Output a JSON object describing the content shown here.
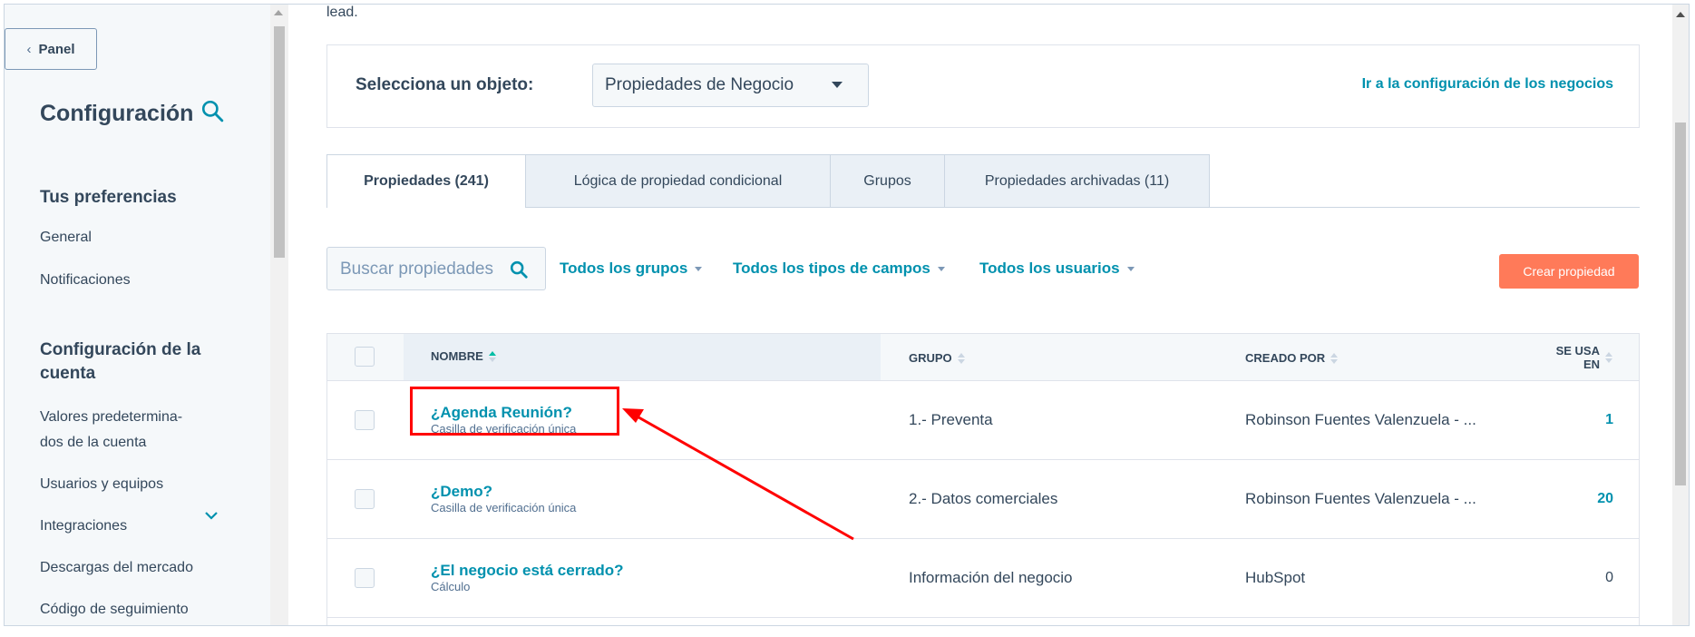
{
  "sidebar": {
    "panel_label": "Panel",
    "title": "Configuración",
    "section_prefs": "Tus preferencias",
    "prefs_items": [
      "General",
      "Notificaciones"
    ],
    "section_account": "Configuración de la cuenta",
    "account_items": [
      "Valores predetermina-",
      "dos de la cuenta",
      "Usuarios y equipos",
      "Integraciones",
      "Descargas del mercado",
      "Código de seguimiento"
    ]
  },
  "main": {
    "lead_text": "lead.",
    "object_label": "Selecciona un objeto:",
    "object_value": "Propiedades de Negocio",
    "object_link": "Ir a la configuración de los negocios",
    "tabs": [
      {
        "label": "Propiedades (241)"
      },
      {
        "label": "Lógica de propiedad condicional"
      },
      {
        "label": "Grupos"
      },
      {
        "label": "Propiedades archivadas (11)"
      }
    ],
    "search_placeholder": "Buscar propiedades",
    "filters": [
      "Todos los grupos",
      "Todos los tipos de campos",
      "Todos los usuarios"
    ],
    "create_button": "Crear propiedad"
  },
  "table": {
    "headers": {
      "name": "NOMBRE",
      "group": "GRUPO",
      "created_by": "CREADO POR",
      "used_in_1": "SE USA",
      "used_in_2": "EN"
    },
    "rows": [
      {
        "name": "¿Agenda Reunión?",
        "type": "Casilla de verificación única",
        "group": "1.- Preventa",
        "created_by": "Robinson Fuentes Valenzuela - ...",
        "used_in": "1"
      },
      {
        "name": "¿Demo?",
        "type": "Casilla de verificación única",
        "group": "2.- Datos comerciales",
        "created_by": "Robinson Fuentes Valenzuela - ...",
        "used_in": "20"
      },
      {
        "name": "¿El negocio está cerrado?",
        "type": "Cálculo",
        "group": "Información del negocio",
        "created_by": "HubSpot",
        "used_in": "0"
      }
    ]
  },
  "colors": {
    "accent": "#0091ae",
    "create_button": "#ff7a59",
    "annotation": "#ff0000"
  }
}
